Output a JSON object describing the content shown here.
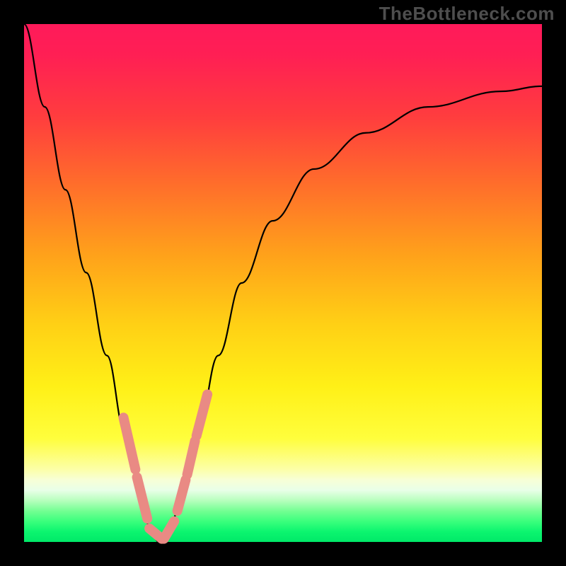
{
  "watermark": "TheBottleneck.com",
  "background": {
    "stops": [
      {
        "offset": 0.0,
        "color": "#ff1a5a"
      },
      {
        "offset": 0.06,
        "color": "#ff1f54"
      },
      {
        "offset": 0.18,
        "color": "#ff3d3e"
      },
      {
        "offset": 0.3,
        "color": "#ff6a2c"
      },
      {
        "offset": 0.45,
        "color": "#ffa31a"
      },
      {
        "offset": 0.58,
        "color": "#ffd015"
      },
      {
        "offset": 0.7,
        "color": "#fff017"
      },
      {
        "offset": 0.8,
        "color": "#fffe3c"
      },
      {
        "offset": 0.86,
        "color": "#fcffa8"
      },
      {
        "offset": 0.88,
        "color": "#f7ffd6"
      },
      {
        "offset": 0.9,
        "color": "#e9ffe8"
      },
      {
        "offset": 0.92,
        "color": "#b7ffbd"
      },
      {
        "offset": 0.94,
        "color": "#74ff93"
      },
      {
        "offset": 0.96,
        "color": "#3bff7d"
      },
      {
        "offset": 0.98,
        "color": "#0cf56f"
      },
      {
        "offset": 1.0,
        "color": "#00e968"
      }
    ]
  },
  "chart_data": {
    "type": "line",
    "title": "",
    "xlabel": "",
    "ylabel": "",
    "xlim": [
      0,
      100
    ],
    "ylim": [
      0,
      100
    ],
    "series": [
      {
        "name": "bottleneck-curve",
        "x": [
          0.0,
          4.0,
          8.0,
          12.0,
          16.0,
          19.5,
          22.5,
          24.5,
          26.0,
          28.0,
          30.5,
          33.5,
          37.5,
          42.0,
          48.0,
          56.0,
          66.0,
          78.0,
          92.0,
          100.0
        ],
        "y": [
          100,
          84,
          68,
          52,
          36,
          21,
          9,
          2,
          0,
          2,
          9,
          21,
          36,
          50,
          62,
          72,
          79,
          84,
          87,
          88
        ]
      }
    ],
    "markers": {
      "name": "highlight-markers",
      "color": "#e98a84",
      "segments": [
        {
          "x": [
            19.2,
            21.5
          ],
          "y": [
            24.0,
            14.0
          ]
        },
        {
          "x": [
            21.8,
            23.8
          ],
          "y": [
            12.5,
            4.5
          ]
        },
        {
          "x": [
            24.2,
            26.6
          ],
          "y": [
            2.6,
            0.6
          ]
        },
        {
          "x": [
            27.0,
            29.0
          ],
          "y": [
            0.6,
            4.0
          ]
        },
        {
          "x": [
            29.6,
            31.2
          ],
          "y": [
            6.0,
            12.0
          ]
        },
        {
          "x": [
            31.5,
            33.0
          ],
          "y": [
            13.0,
            19.5
          ]
        },
        {
          "x": [
            33.3,
            35.4
          ],
          "y": [
            20.5,
            28.5
          ]
        }
      ]
    }
  }
}
